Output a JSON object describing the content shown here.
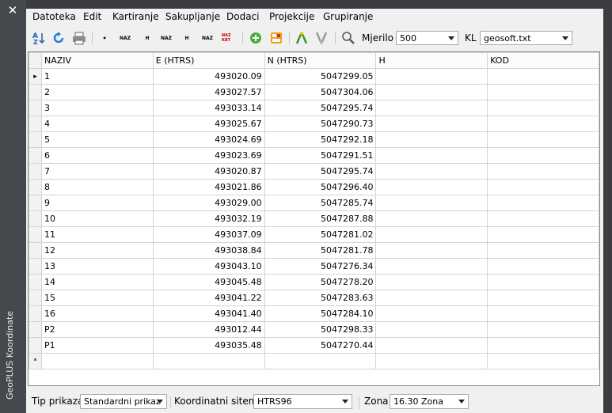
{
  "window": {
    "vertical_title": "GeoPLUS Koordinate",
    "close_glyph": "✕"
  },
  "menu": [
    "Datoteka",
    "Edit",
    "Kartiranje",
    "Sakupljanje",
    "Dodaci",
    "Projekcije",
    "Grupiranje"
  ],
  "toolbar": {
    "mjerilo_label": "Mjerilo",
    "mjerilo_value": "500",
    "kl_label": "KL",
    "kl_value": "geosoft.txt",
    "tiny_labels": [
      "•",
      "NAZ",
      "H",
      "NAZ",
      "H",
      "NAZ",
      "NAZ KBT"
    ]
  },
  "table": {
    "columns": [
      "NAZIV",
      "E (HTRS)",
      "N (HTRS)",
      "H",
      "KOD"
    ],
    "current_row_marker": "▸",
    "new_row_marker": "*",
    "rows": [
      [
        "1",
        "493020.09",
        "5047299.05",
        "",
        ""
      ],
      [
        "2",
        "493027.57",
        "5047304.06",
        "",
        ""
      ],
      [
        "3",
        "493033.14",
        "5047295.74",
        "",
        ""
      ],
      [
        "4",
        "493025.67",
        "5047290.73",
        "",
        ""
      ],
      [
        "5",
        "493024.69",
        "5047292.18",
        "",
        ""
      ],
      [
        "6",
        "493023.69",
        "5047291.51",
        "",
        ""
      ],
      [
        "7",
        "493020.87",
        "5047295.74",
        "",
        ""
      ],
      [
        "8",
        "493021.86",
        "5047296.40",
        "",
        ""
      ],
      [
        "9",
        "493029.00",
        "5047285.74",
        "",
        ""
      ],
      [
        "10",
        "493032.19",
        "5047287.88",
        "",
        ""
      ],
      [
        "11",
        "493037.09",
        "5047281.02",
        "",
        ""
      ],
      [
        "12",
        "493038.84",
        "5047281.78",
        "",
        ""
      ],
      [
        "13",
        "493043.10",
        "5047276.34",
        "",
        ""
      ],
      [
        "14",
        "493045.48",
        "5047278.20",
        "",
        ""
      ],
      [
        "15",
        "493041.22",
        "5047283.63",
        "",
        ""
      ],
      [
        "16",
        "493041.40",
        "5047284.10",
        "",
        ""
      ],
      [
        "P2",
        "493012.44",
        "5047298.33",
        "",
        ""
      ],
      [
        "P1",
        "493035.48",
        "5047270.44",
        "",
        ""
      ]
    ]
  },
  "status": {
    "tip_label": "Tip prikaza",
    "tip_value": "Standardni prikaz",
    "koord_label": "Koordinatni sitem:",
    "koord_value": "HTRS96",
    "zona_label": "Zona",
    "zona_value": "16.30 Zona"
  },
  "icons": [
    "sort-az-icon",
    "refresh-icon",
    "print-icon",
    "add-icon",
    "calculator-icon",
    "point-up-icon",
    "point-down-icon",
    "zoom-icon"
  ]
}
